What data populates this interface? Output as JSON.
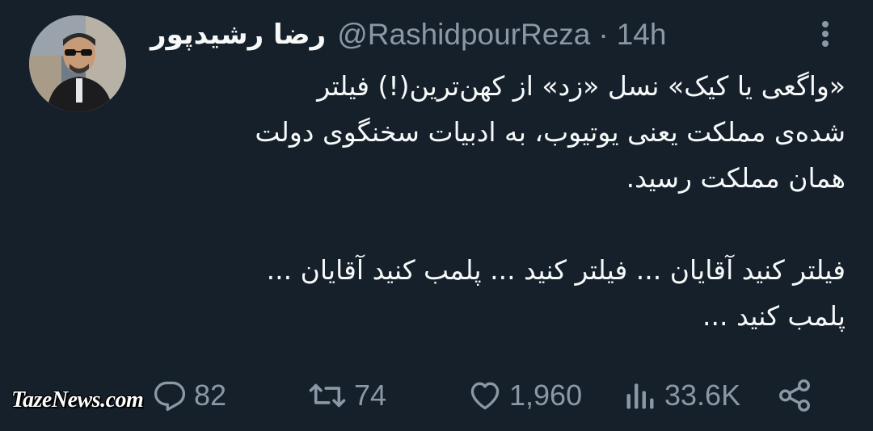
{
  "tweet": {
    "author": {
      "display_name": "رضا رشیدپور",
      "handle": "@RashidpourReza",
      "separator": "·",
      "time": "14h"
    },
    "text_lines": [
      "«واگعی یا کیک» نسل «زد» از کهن‌ترین(!) فیلتر",
      "شده‌ی مملکت یعنی یوتیوب، به ادبیات سخنگوی دولت",
      "همان مملکت رسید.",
      "فیلتر کنید آقایان ... فیلتر کنید ... پلمب کنید آقایان ...",
      "پلمب کنید ..."
    ],
    "stats": {
      "replies": "82",
      "retweets": "74",
      "likes": "1,960",
      "views": "33.6K"
    }
  },
  "icons": {
    "more": "more-vertical-icon",
    "reply": "reply-icon",
    "retweet": "retweet-icon",
    "like": "heart-icon",
    "views": "views-icon",
    "share": "share-icon"
  },
  "watermark": "TazeNews.com",
  "colors": {
    "background": "#15202b",
    "primary_text": "#f7f9f9",
    "secondary_text": "#8b98a5"
  }
}
